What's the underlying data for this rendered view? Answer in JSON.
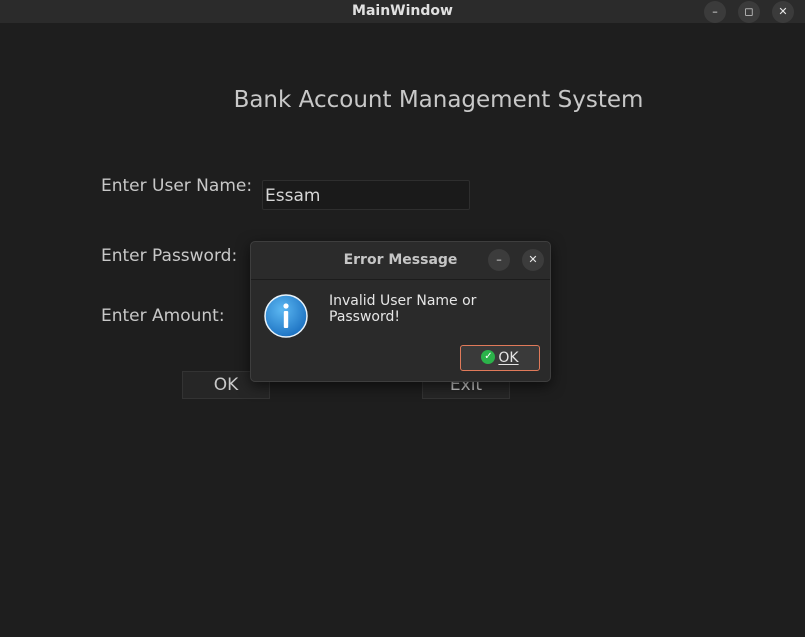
{
  "window": {
    "title": "MainWindow",
    "controls": [
      "minimize-icon",
      "maximize-icon",
      "close-icon"
    ]
  },
  "form": {
    "heading": "Bank Account Management System",
    "username_label": "Enter User Name:",
    "username_value": "Essam",
    "password_label": "Enter Password:",
    "amount_label": "Enter Amount:",
    "ok_label": "OK",
    "exit_label": "Exit"
  },
  "dialog": {
    "title": "Error Message",
    "icon": "info-icon",
    "message": "Invalid User Name or Password!",
    "ok_label": "OK",
    "ok_border_color": "#e07a5a",
    "check_color": "#2bb34a"
  }
}
